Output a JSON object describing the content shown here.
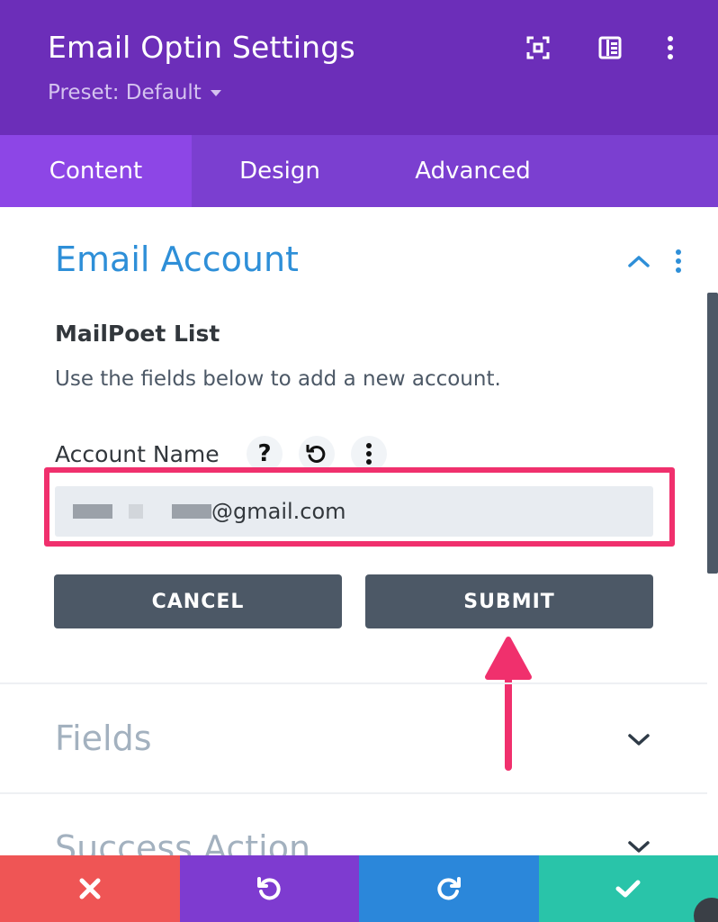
{
  "header": {
    "title": "Email Optin Settings",
    "preset": "Preset: Default",
    "background": "#6c2eb9",
    "icons": [
      "expand-icon",
      "sidebar-icon",
      "more-vertical-icon"
    ]
  },
  "tabs": [
    {
      "label": "Content",
      "active": true
    },
    {
      "label": "Design",
      "active": false
    },
    {
      "label": "Advanced",
      "active": false
    }
  ],
  "email_account": {
    "section_title": "Email Account",
    "expanded": true,
    "field_title": "MailPoet List",
    "description": "Use the fields below to add a new account.",
    "account_label": "Account Name",
    "account_value_visible": "@gmail.com",
    "cancel_label": "CANCEL",
    "submit_label": "SUBMIT"
  },
  "sections": [
    {
      "title": "Fields",
      "expanded": false
    },
    {
      "title": "Success Action",
      "expanded": false
    }
  ],
  "footer": [
    {
      "name": "discard-icon",
      "color": "#ef5555"
    },
    {
      "name": "undo-icon",
      "color": "#7e3bd0"
    },
    {
      "name": "redo-icon",
      "color": "#2b87da"
    },
    {
      "name": "save-check-icon",
      "color": "#29c4a9"
    }
  ],
  "colors": {
    "accent_blue": "#2e8fd8",
    "highlight": "#f0306d",
    "button": "#4c5866"
  }
}
